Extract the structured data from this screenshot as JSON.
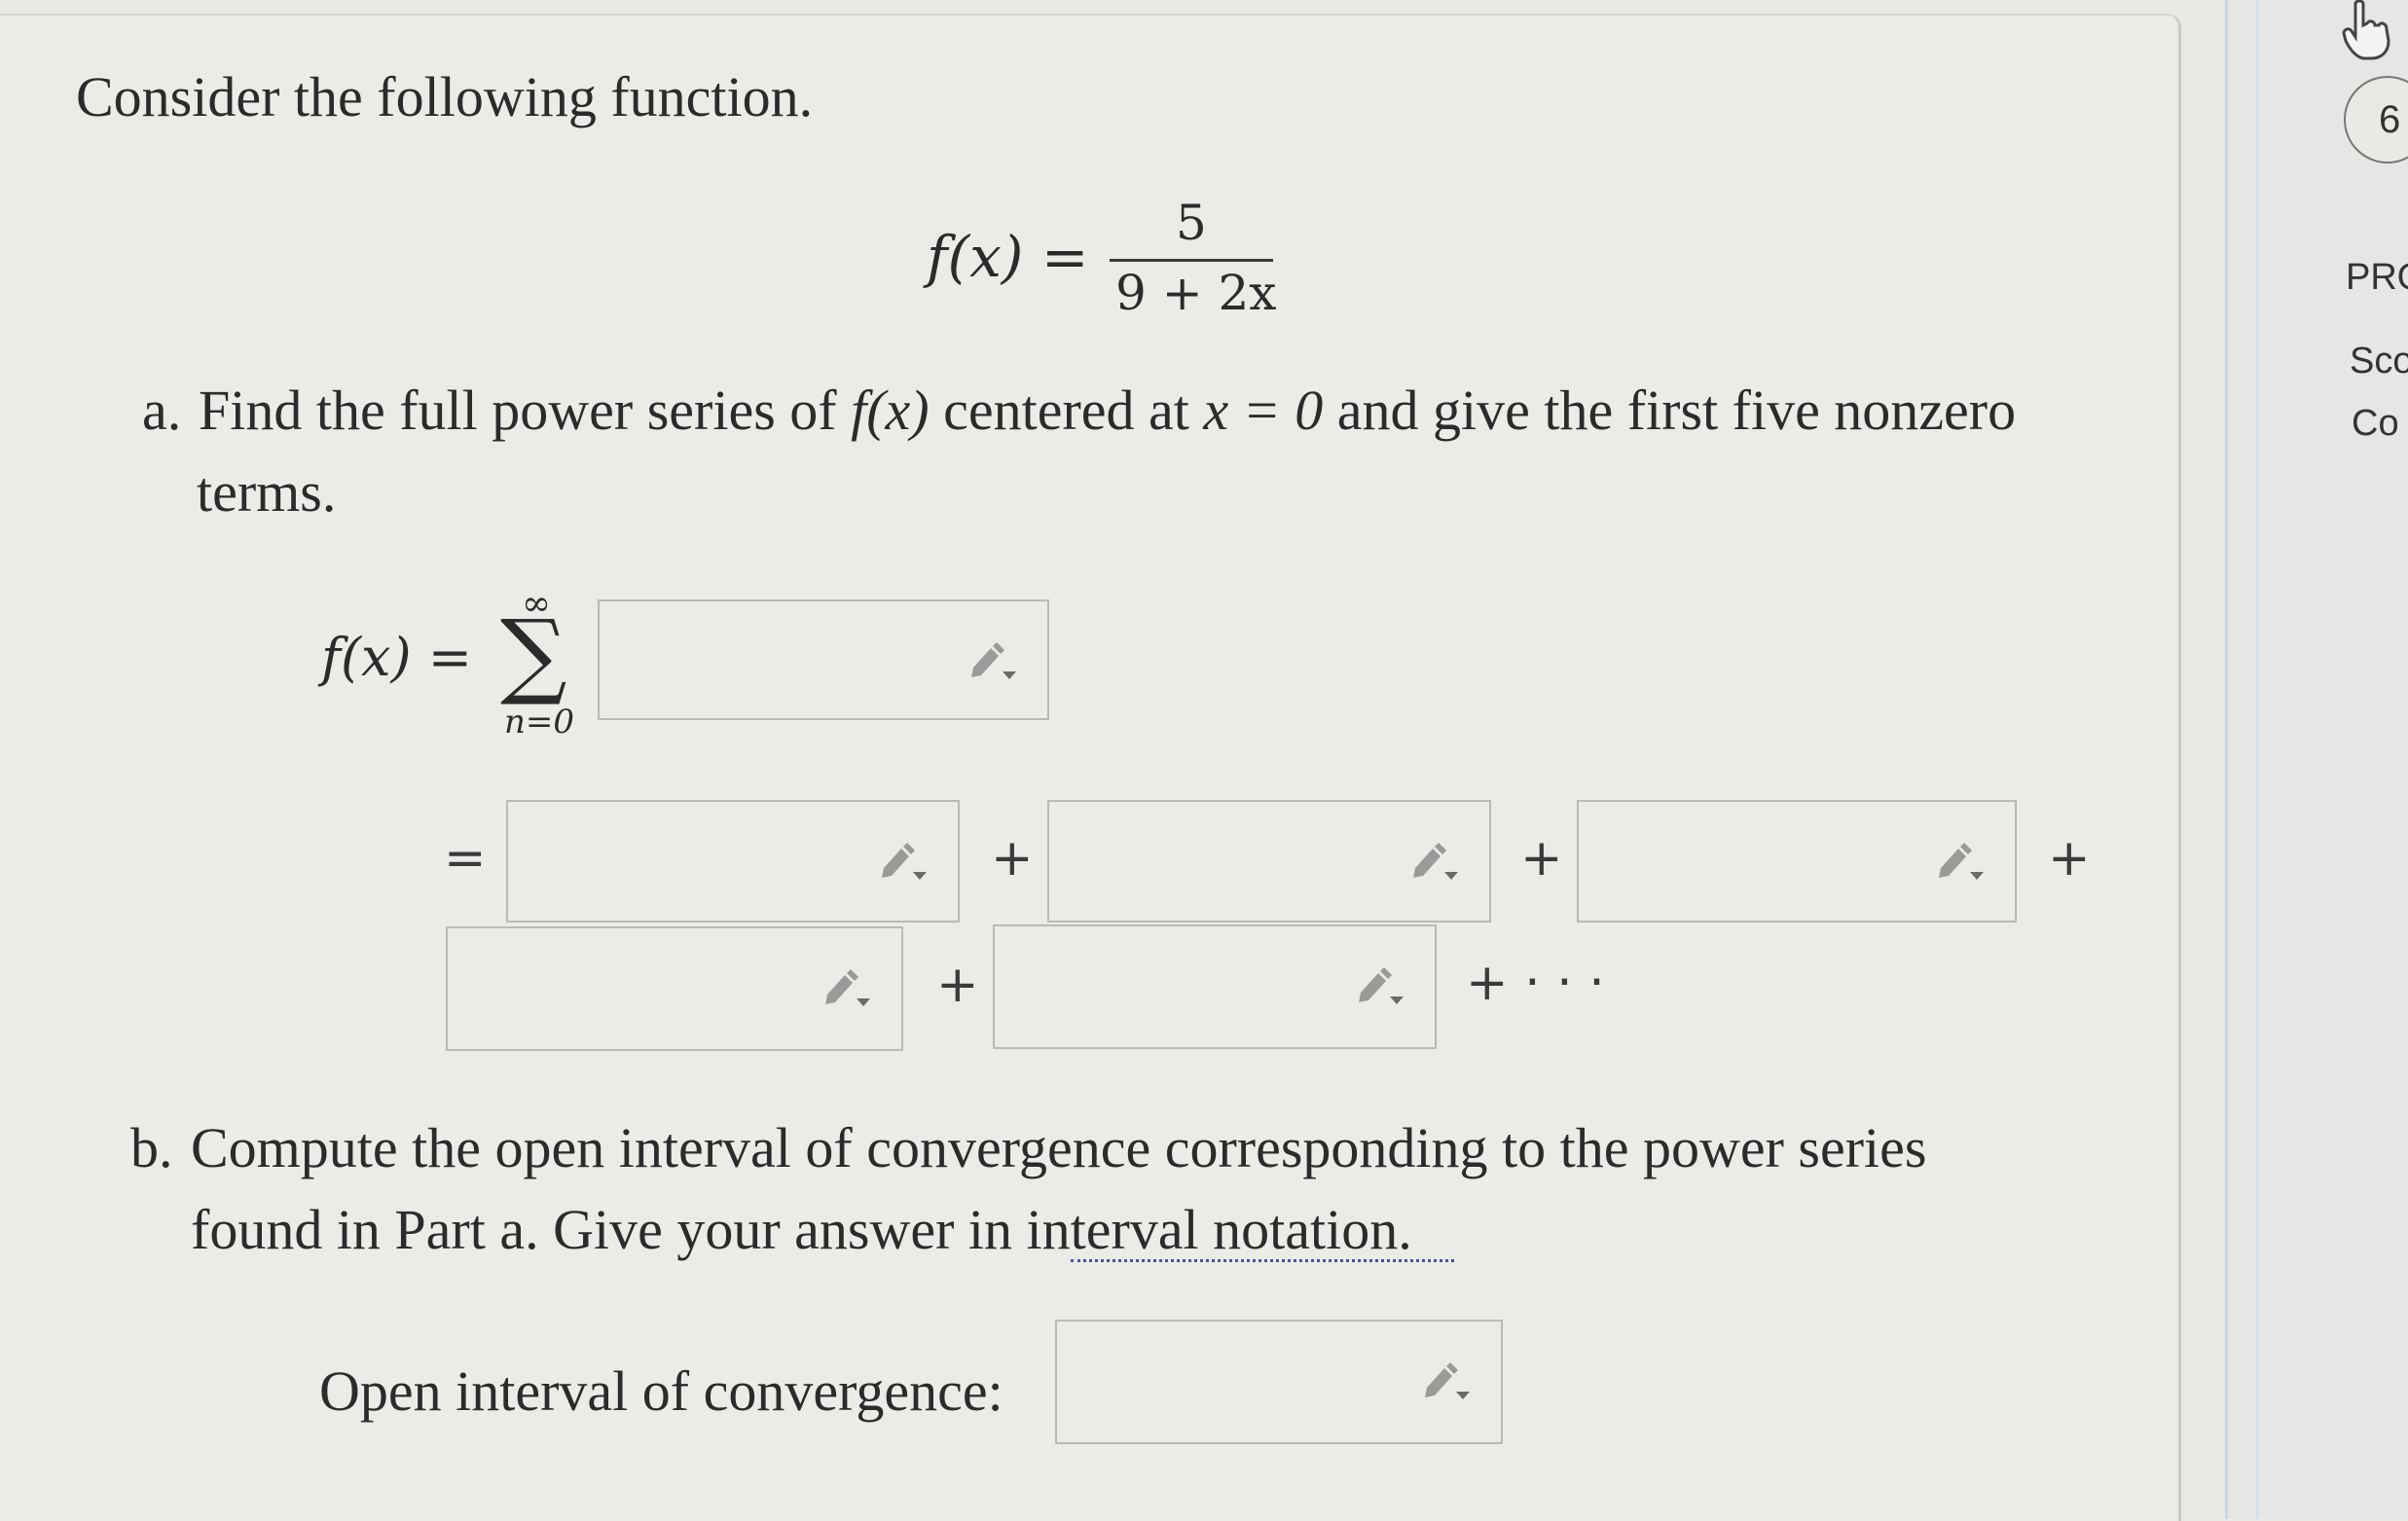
{
  "intro": "Consider the following function.",
  "function_def": {
    "lhs": "f(x) =",
    "numerator": "5",
    "denominator": "9 + 2x"
  },
  "part_a": {
    "label": "a.",
    "text_line1_pre": "Find the full power series of ",
    "text_fx": "f(x)",
    "text_line1_mid": " centered at ",
    "text_x0": "x = 0",
    "text_line1_post": " and give the first five nonzero",
    "text_line2": "terms.",
    "series_lhs": "f(x) =",
    "sigma": "∑",
    "upper_limit": "∞",
    "lower_limit": "n=0",
    "equals": "=",
    "plus": "+",
    "trailing": "+ · · ·",
    "answer_boxes": [
      "",
      "",
      "",
      "",
      "",
      ""
    ]
  },
  "part_b": {
    "label": "b.",
    "text_line1": "Compute the open interval of convergence corresponding to the power series",
    "text_line2_pre": "found in Part a. Give your answer in ",
    "text_link": "interval notation.",
    "answer_label": "Open interval of convergence:",
    "answer_value": ""
  },
  "sidebar": {
    "question_number": "6",
    "items": [
      "PRO",
      "Sco",
      "Co"
    ]
  },
  "icons": {
    "answer_editor": "pencil-dropdown-icon",
    "cursor": "hand-pointer-icon"
  },
  "colors": {
    "background": "#ebebe8",
    "box_border": "#b9b9b6",
    "link_underline": "#3a5a9a"
  }
}
